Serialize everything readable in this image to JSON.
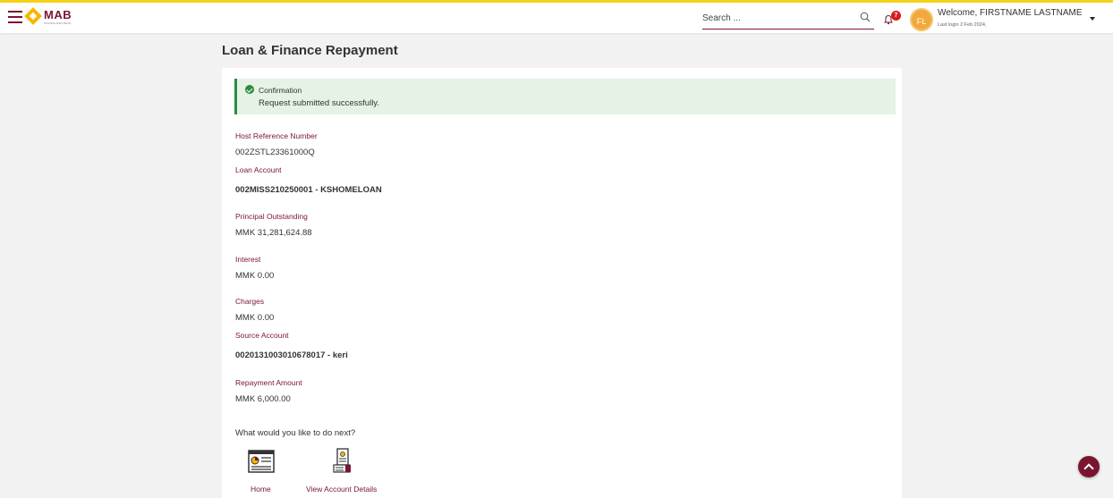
{
  "header": {
    "brand": "MAB",
    "tagline": "MYANMA APEX BANK",
    "search_placeholder": "Search ...",
    "notification_count": "7",
    "avatar_initials": "FL",
    "welcome_text": "Welcome, FIRSTNAME LASTNAME",
    "last_login": "Last login 2 Feb 2024,"
  },
  "page": {
    "title": "Loan & Finance Repayment"
  },
  "confirmation": {
    "title": "Confirmation",
    "message": "Request submitted successfully."
  },
  "details": [
    {
      "label": "Host Reference Number",
      "value": "002ZSTL23361000Q",
      "bold": false
    },
    {
      "label": "Loan Account",
      "value": "002MISS210250001 - KSHOMELOAN",
      "bold": true
    },
    {
      "label": "Principal Outstanding",
      "value": "MMK 31,281,624.88",
      "bold": false
    },
    {
      "label": "Interest",
      "value": "MMK 0.00",
      "bold": false
    },
    {
      "label": "Charges",
      "value": "MMK 0.00",
      "bold": false
    },
    {
      "label": "Source Account",
      "value": "0020131003010678017 - keri",
      "bold": true
    },
    {
      "label": "Repayment Amount",
      "value": "MMK 6,000.00",
      "bold": false
    }
  ],
  "next_steps": {
    "question": "What would you like to do next?",
    "actions": [
      {
        "label": "Home",
        "icon": "home-dashboard-icon"
      },
      {
        "label": "View Account Details",
        "icon": "account-details-icon"
      }
    ]
  },
  "colors": {
    "brand_maroon": "#7a1530",
    "brand_yellow": "#f5d21a",
    "success_green": "#2e8b3d",
    "success_bg": "#e4f3e5"
  }
}
